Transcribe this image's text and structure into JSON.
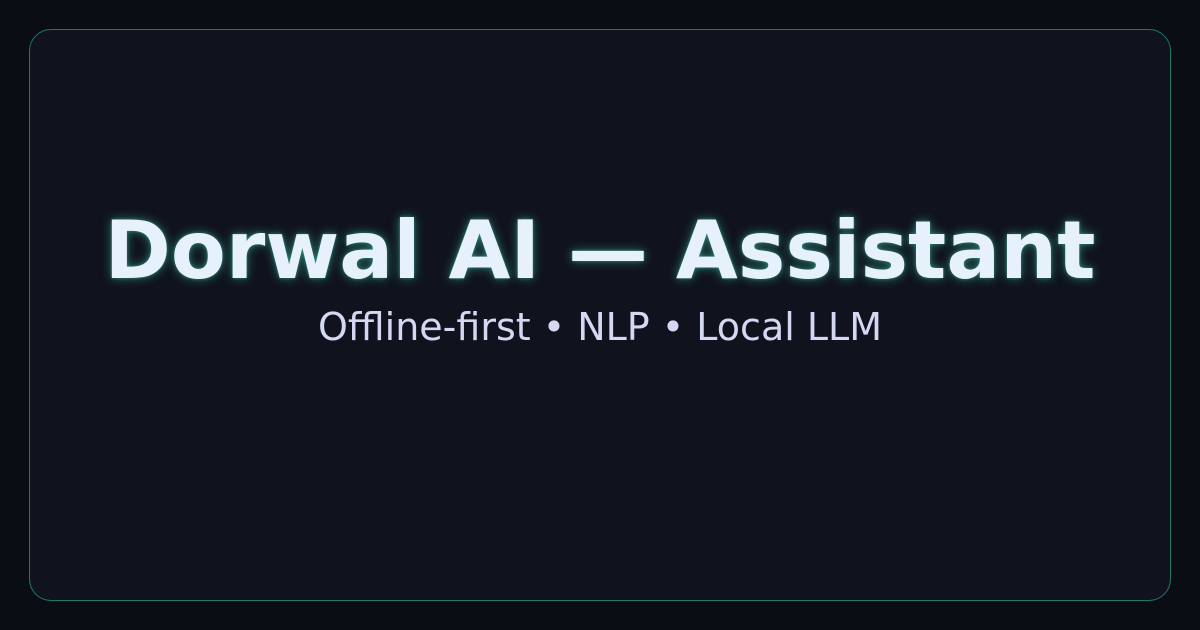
{
  "card": {
    "title": "Dorwal AI — Assistant",
    "subtitle": "Offline-first • NLP • Local LLM"
  },
  "colors": {
    "background": "#0a0d14",
    "card_background": "#10131e",
    "card_border": "#1f7a64",
    "title_text": "#e7f1fb",
    "title_glow": "#40c8aa",
    "subtitle_text": "#d4d8f2"
  }
}
